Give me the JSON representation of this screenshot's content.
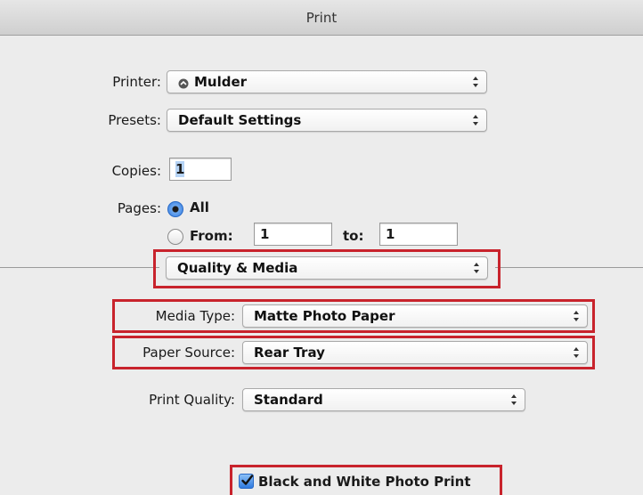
{
  "window": {
    "title": "Print"
  },
  "printer": {
    "label": "Printer:",
    "value": "Mulder"
  },
  "presets": {
    "label": "Presets:",
    "value": "Default Settings"
  },
  "copies": {
    "label": "Copies:",
    "value": "1"
  },
  "pages": {
    "label": "Pages:",
    "all_label": "All",
    "from_label": "From:",
    "from_value": "1",
    "to_label": "to:",
    "to_value": "1",
    "selected": "All"
  },
  "section": {
    "value": "Quality & Media"
  },
  "media_type": {
    "label": "Media Type:",
    "value": "Matte Photo Paper"
  },
  "paper_source": {
    "label": "Paper Source:",
    "value": "Rear Tray"
  },
  "print_quality": {
    "label": "Print Quality:",
    "value": "Standard"
  },
  "bw_photo": {
    "label": "Black and White Photo Print",
    "checked": true
  },
  "colors": {
    "highlight": "#c8232c",
    "accent": "#2f7ae0"
  }
}
